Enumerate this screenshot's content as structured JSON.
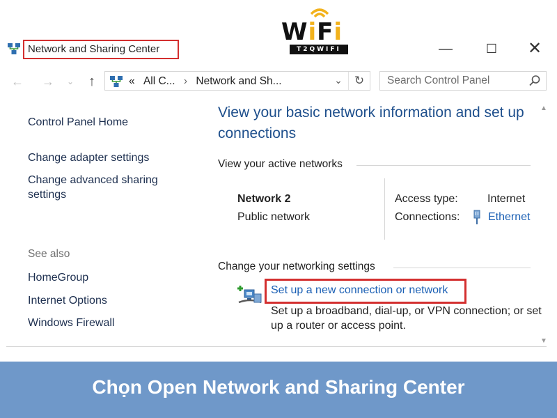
{
  "logo": {
    "word_part1": "W",
    "word_i1": "i",
    "word_part2": "F",
    "word_i2": "i",
    "banner": "T2QWIFI"
  },
  "window": {
    "title": "Network and Sharing Center",
    "controls": {
      "minimize": "—",
      "maximize": "☐",
      "close": "✕"
    }
  },
  "nav": {
    "back": "←",
    "forward": "→",
    "recent": "⌄",
    "up": "↑",
    "address": {
      "prefix": "«",
      "crumb1": "All C...",
      "sep": "›",
      "crumb2": "Network and Sh...",
      "dropdown": "⌄",
      "refresh": "↻"
    },
    "search_placeholder": "Search Control Panel"
  },
  "sidebar": {
    "home": "Control Panel Home",
    "links": [
      "Change adapter settings",
      "Change advanced sharing settings"
    ],
    "see_also_label": "See also",
    "see_also": [
      "HomeGroup",
      "Internet Options",
      "Windows Firewall"
    ]
  },
  "main": {
    "title": "View your basic network information and set up connections",
    "active_networks_label": "View your active networks",
    "network": {
      "name": "Network  2",
      "type": "Public network"
    },
    "access_type_label": "Access type:",
    "access_type_value": "Internet",
    "connections_label": "Connections:",
    "connections_value": "Ethernet",
    "change_settings_label": "Change your networking settings",
    "setup_link": "Set up a new connection or network",
    "setup_desc": "Set up a broadband, dial-up, or VPN connection; or set up a router or access point."
  },
  "caption": "Chọn Open Network and Sharing Center",
  "colors": {
    "highlight_red": "#d32f2f",
    "link_blue": "#1a5fb4",
    "title_blue": "#1e4f8c",
    "caption_bg": "#6f98c9"
  }
}
